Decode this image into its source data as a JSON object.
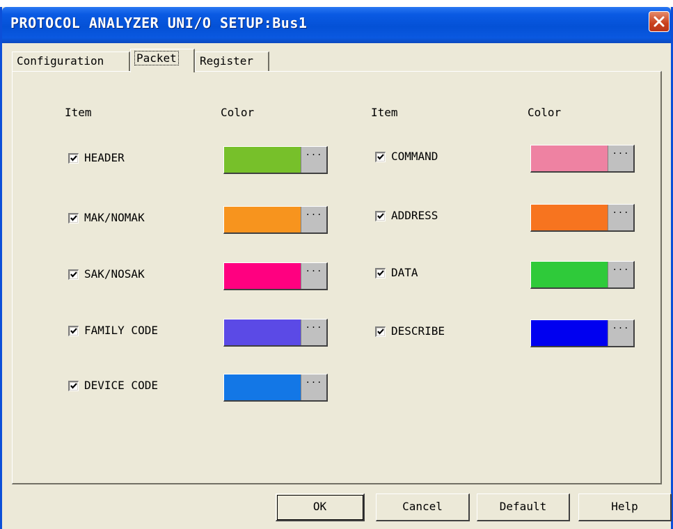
{
  "window": {
    "title": "PROTOCOL ANALYZER UNI/O SETUP:Bus1"
  },
  "tabs": [
    {
      "label": "Configuration"
    },
    {
      "label": "Packet"
    },
    {
      "label": "Register"
    }
  ],
  "columns": {
    "item_header": "Item",
    "color_header": "Color"
  },
  "left_items": [
    {
      "label": "HEADER",
      "checked": true,
      "color": "#77c02a"
    },
    {
      "label": "MAK/NOMAK",
      "checked": true,
      "color": "#f7941e"
    },
    {
      "label": "SAK/NOSAK",
      "checked": true,
      "color": "#ff0080"
    },
    {
      "label": "FAMILY CODE",
      "checked": true,
      "color": "#5b4ae6"
    },
    {
      "label": "DEVICE CODE",
      "checked": true,
      "color": "#1377e6"
    }
  ],
  "right_items": [
    {
      "label": "COMMAND",
      "checked": true,
      "color": "#ee82a2"
    },
    {
      "label": "ADDRESS",
      "checked": true,
      "color": "#f7741f"
    },
    {
      "label": "DATA",
      "checked": true,
      "color": "#2fca3a"
    },
    {
      "label": "DESCRIBE",
      "checked": true,
      "color": "#0000f0"
    }
  ],
  "swatch_button_label": "...",
  "buttons": {
    "ok": "OK",
    "cancel": "Cancel",
    "default": "Default",
    "help": "Help"
  },
  "colors": {
    "titlebar": "#0451d6",
    "dialog_bg": "#ece9d8",
    "close_button": "#c9401d"
  }
}
